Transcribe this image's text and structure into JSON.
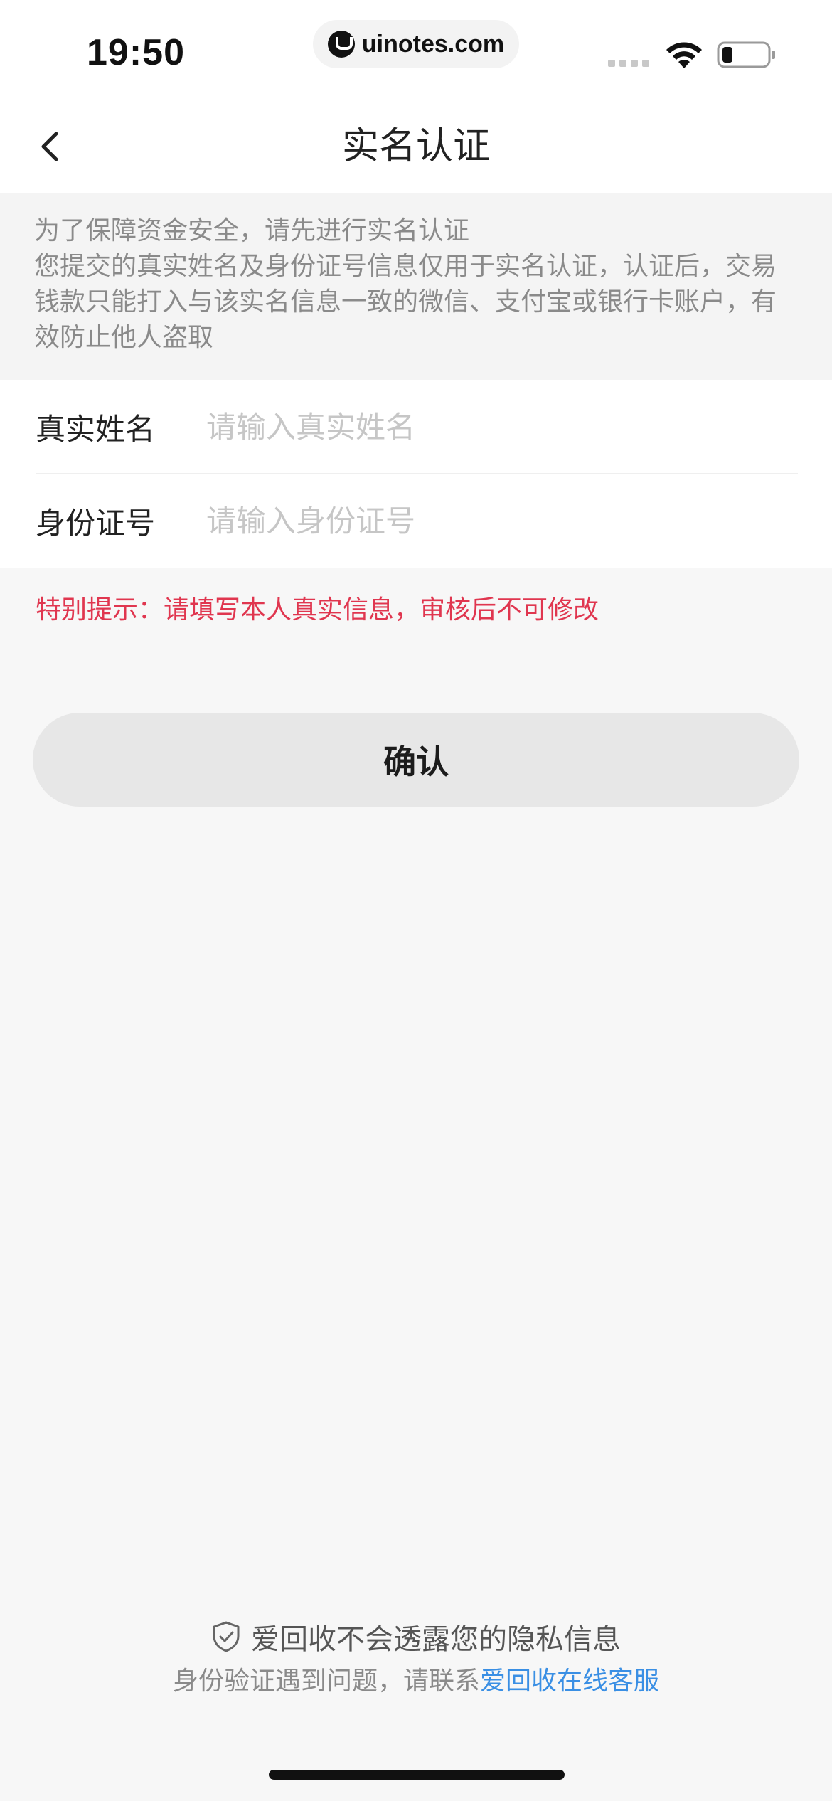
{
  "status_bar": {
    "time": "19:50",
    "url": "uinotes.com"
  },
  "nav": {
    "title": "实名认证"
  },
  "notice": {
    "line1": "为了保障资金安全，请先进行实名认证",
    "line2": "您提交的真实姓名及身份证号信息仅用于实名认证，认证后，交易钱款只能打入与该实名信息一致的微信、支付宝或银行卡账户，有效防止他人盗取"
  },
  "form": {
    "name_label": "真实姓名",
    "name_placeholder": "请输入真实姓名",
    "id_label": "身份证号",
    "id_placeholder": "请输入身份证号"
  },
  "warning": "特别提示：请填写本人真实信息，审核后不可修改",
  "confirm_label": "确认",
  "footer": {
    "privacy": "爱回收不会透露您的隐私信息",
    "help_prefix": "身份验证遇到问题，请联系",
    "help_link": "爱回收在线客服"
  },
  "colors": {
    "warning": "#e0364f",
    "link": "#3a8fe4",
    "button_bg": "#e7e7e7"
  },
  "icons": {
    "back": "chevron-left-icon",
    "privacy": "shield-check-icon",
    "wifi": "wifi-icon",
    "battery": "battery-low-icon"
  }
}
